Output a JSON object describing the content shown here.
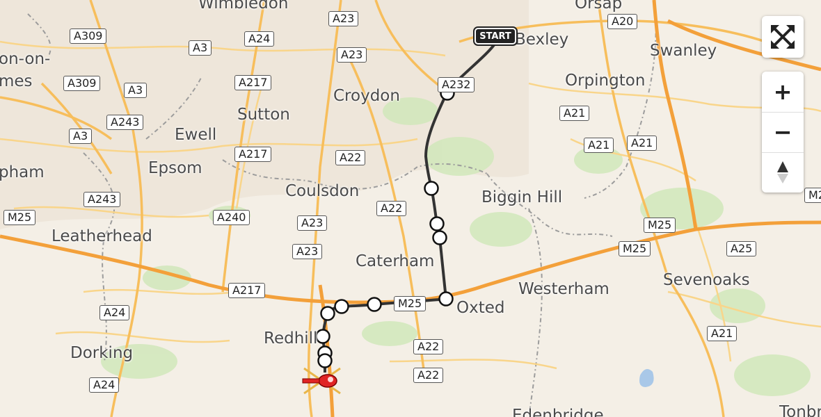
{
  "map": {
    "places": [
      "Wimbledon",
      "Bexley",
      "Swanley",
      "Orpington",
      "Croydon",
      "Sutton",
      "Ewell",
      "Epsom",
      "on-on-",
      "mes",
      "pham",
      "Coulsdon",
      "Biggin Hill",
      "Leatherhead",
      "Caterham",
      "Westerham",
      "Sevenoaks",
      "Oxted",
      "Redhill",
      "Dorking",
      "Edenbridge",
      "Tonbridge",
      "Orsap"
    ],
    "roads": [
      "A23",
      "A20",
      "A309",
      "A24",
      "A3",
      "A23",
      "A232",
      "A217",
      "A309",
      "A3",
      "A21",
      "A243",
      "A3",
      "A21",
      "A21",
      "A217",
      "A22",
      "A22",
      "M25",
      "A243",
      "A240",
      "A23",
      "M25",
      "M25",
      "A25",
      "A23",
      "M2",
      "A217",
      "M25",
      "A24",
      "A22",
      "A21",
      "A22",
      "A24"
    ],
    "route": {
      "start_label": "START",
      "color": "#333333",
      "waypoint_count": 11
    }
  },
  "controls": {
    "fullscreen_icon": "fullscreen-icon",
    "zoom_in": "+",
    "zoom_out": "−",
    "compass_icon": "compass-icon"
  },
  "colors": {
    "background": "#f4efe6",
    "motorway": "#f6a33c",
    "primary_road": "#f9c96a",
    "green": "#cfe6b7",
    "urban": "#ebe4d8",
    "border": "#9c9c9c"
  }
}
